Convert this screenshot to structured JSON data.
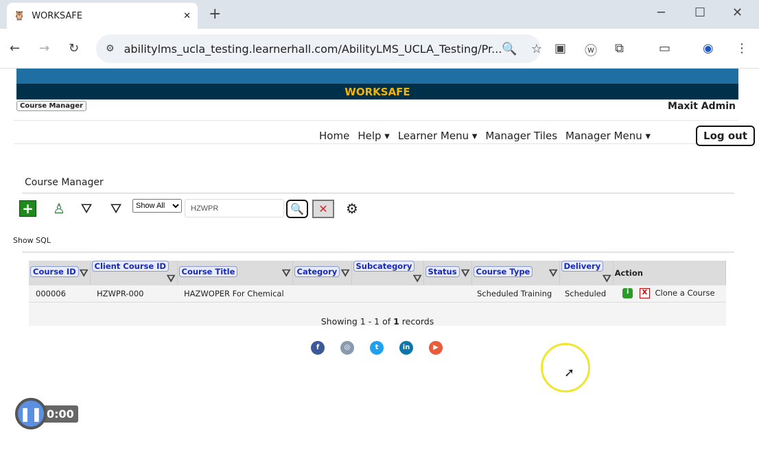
{
  "browser": {
    "tab_title": "WORKSAFE",
    "url": "abilitylms_ucla_testing.learnerhall.com/AbilityLMS_UCLA_Testing/Pr..."
  },
  "site": {
    "brand": "WORKSAFE",
    "badge": "Course Manager",
    "user": "Maxit Admin"
  },
  "nav": {
    "items": [
      "Home",
      "Help ▾",
      "Learner Menu ▾",
      "Manager Tiles",
      "Manager Menu ▾"
    ],
    "logout": "Log out"
  },
  "page": {
    "title": "Course Manager",
    "show_select": "Show All",
    "search_value": "HZWPR",
    "show_sql": "Show SQL"
  },
  "table": {
    "headers": [
      "Course ID",
      "Client Course ID",
      "Course Title",
      "Category",
      "Subcategory",
      "Status",
      "Course Type",
      "Delivery",
      "Action"
    ],
    "rows": [
      {
        "course_id": "000006",
        "client_id": "HZWPR-000",
        "title": "HAZWOPER For Chemical",
        "category": "",
        "subcategory": "",
        "status": "",
        "type": "Scheduled Training",
        "delivery": "Scheduled",
        "action_link": "Clone a Course"
      }
    ],
    "footer_pre": "Showing 1 - 1 of ",
    "footer_count": "1",
    "footer_post": " records"
  },
  "player": {
    "time": "0:00"
  }
}
